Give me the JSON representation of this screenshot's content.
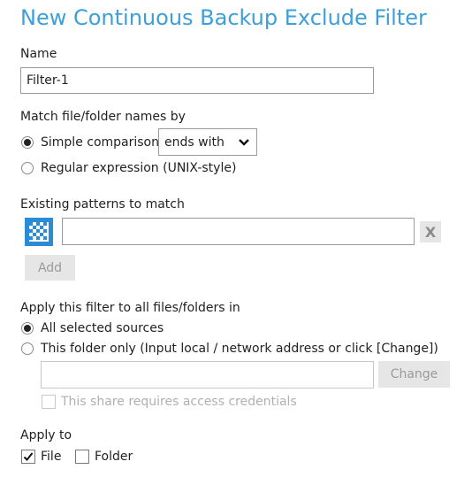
{
  "title": "New Continuous Backup Exclude Filter",
  "name_section": {
    "label": "Name",
    "value": "Filter-1"
  },
  "match_section": {
    "label": "Match file/folder names by",
    "simple_label": "Simple comparison",
    "simple_selected": true,
    "comparison_value": "ends with",
    "regex_label": "Regular expression (UNIX-style)"
  },
  "patterns_section": {
    "label": "Existing patterns to match",
    "pattern_value": "",
    "remove_label": "X",
    "add_label": "Add"
  },
  "apply_section": {
    "label": "Apply this filter to all files/folders in",
    "all_sources_label": "All selected sources",
    "this_folder_label": "This folder only (Input local / network address or click [Change])",
    "folder_value": "",
    "change_label": "Change",
    "credentials_label": "This share requires access credentials"
  },
  "apply_to_section": {
    "label": "Apply to",
    "file_label": "File",
    "file_checked": true,
    "folder_label": "Folder",
    "folder_checked": false
  },
  "colors": {
    "accent": "#3e9fd8",
    "icon_blue": "#2a8bd6",
    "disabled_bg": "#e6e6e6"
  }
}
